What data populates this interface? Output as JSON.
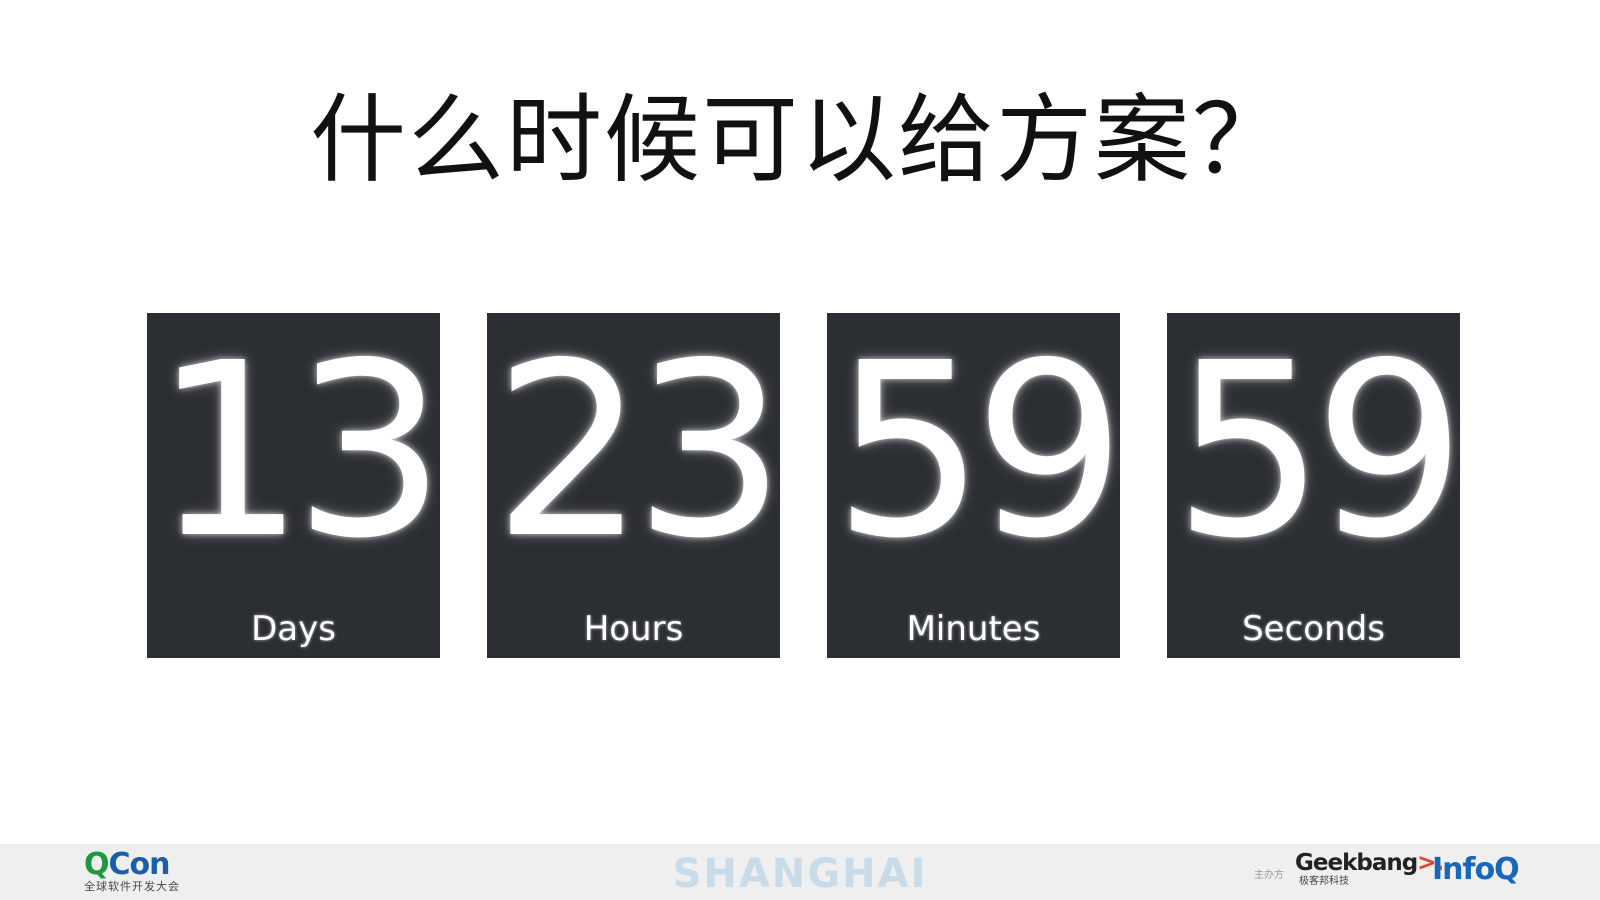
{
  "slide": {
    "title": "什么时候可以给方案？"
  },
  "countdown": [
    {
      "value": "13",
      "label": "Days"
    },
    {
      "value": "23",
      "label": "Hours"
    },
    {
      "value": "59",
      "label": "Minutes"
    },
    {
      "value": "59",
      "label": "Seconds"
    }
  ],
  "footer": {
    "qcon": {
      "q": "Q",
      "con": "Con",
      "subtitle": "全球软件开发大会"
    },
    "city": "SHANGHAI",
    "sponsor_label": "主办方",
    "geekbang": {
      "geek": "Geekbang",
      "arrow": ">.",
      "subtitle": "极客邦科技"
    },
    "infoq": "InfoQ"
  },
  "colors": {
    "tile_background": "#2b2e33",
    "city_text": "#c7dbe9",
    "qcon_green": "#1a9a3c",
    "qcon_blue": "#1b5fa8",
    "infoq_blue": "#1a66b8",
    "geekbang_red": "#e8402a"
  }
}
